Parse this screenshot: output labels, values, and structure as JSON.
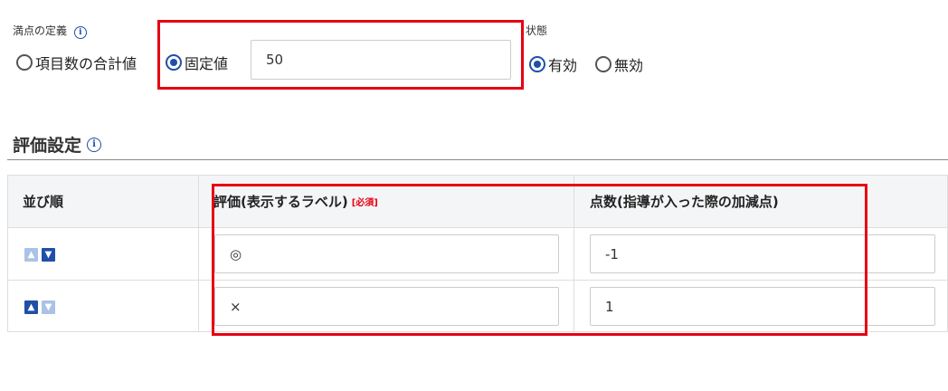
{
  "full_score": {
    "label": "満点の定義",
    "info_icon": "info-icon",
    "options": [
      {
        "label": "項目数の合計値",
        "selected": false
      },
      {
        "label": "固定値",
        "selected": true
      }
    ],
    "fixed_value": "50"
  },
  "status": {
    "label": "状態",
    "options": [
      {
        "label": "有効",
        "selected": true
      },
      {
        "label": "無効",
        "selected": false
      }
    ]
  },
  "evaluation": {
    "title": "評価設定",
    "info_icon": "info-icon",
    "columns": {
      "order": "並び順",
      "label": "評価(表示するラベル)",
      "required": "[必須]",
      "points": "点数(指導が入った際の加減点)"
    },
    "rows": [
      {
        "label_value": "◎",
        "points_value": "-1",
        "up_enabled": false,
        "down_enabled": true
      },
      {
        "label_value": "×",
        "points_value": "1",
        "up_enabled": true,
        "down_enabled": false
      }
    ]
  },
  "colors": {
    "accent": "#1f4fa8",
    "highlight": "#e60012",
    "required": "#e60012"
  },
  "icons": {
    "up": "arrow-up-icon",
    "down": "arrow-down-icon"
  }
}
